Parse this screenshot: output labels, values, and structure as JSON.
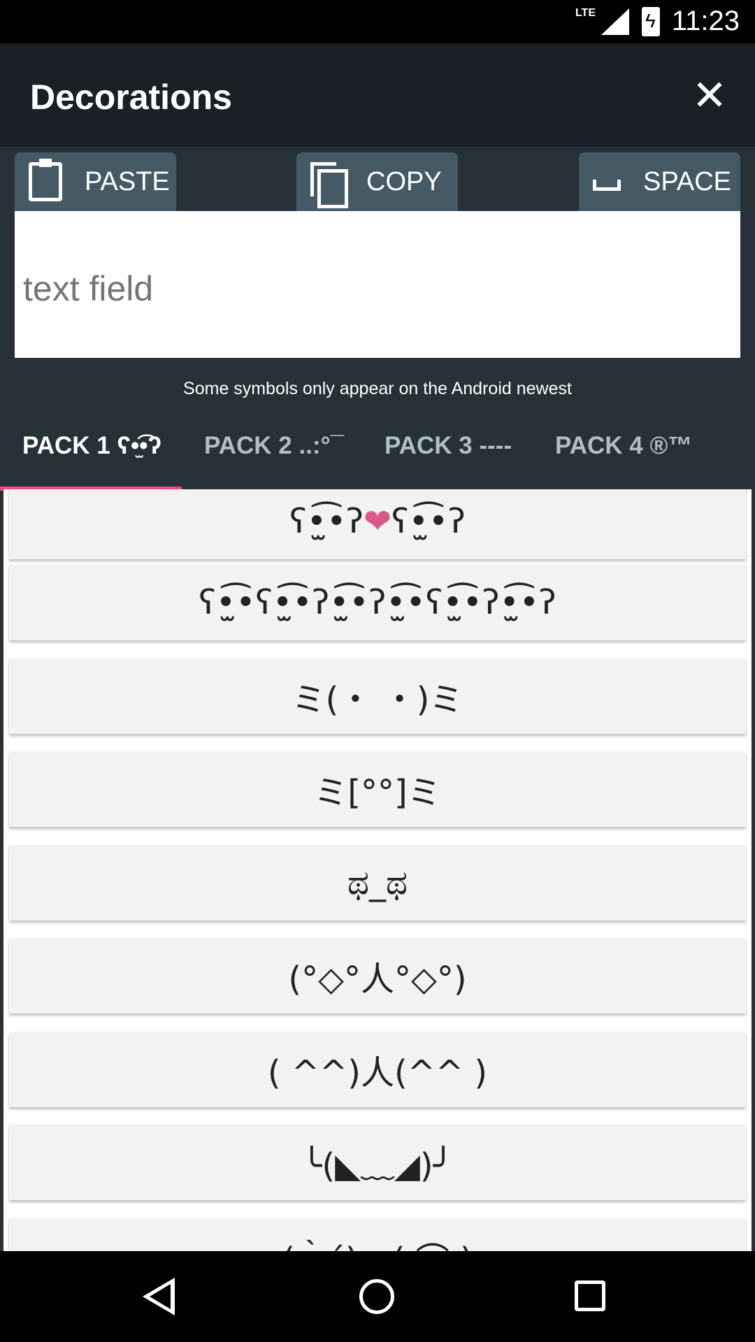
{
  "status_bar": {
    "network": "LTE",
    "time": "11:23"
  },
  "app_bar": {
    "title": "Decorations",
    "close_icon": "close-icon"
  },
  "toolbar": {
    "paste_label": "PASTE",
    "copy_label": "COPY",
    "space_label": "SPACE"
  },
  "text_field": {
    "placeholder": "text field",
    "value": ""
  },
  "notice": "Some symbols only appear on the Android newest",
  "tabs": [
    {
      "label": "PACK 1 ʕ•̫͡•ʔ",
      "active": true
    },
    {
      "label": "PACK 2 ..:°¯",
      "active": false
    },
    {
      "label": "PACK 3 ----",
      "active": false
    },
    {
      "label": "PACK 4 ®™",
      "active": false
    }
  ],
  "colors": {
    "accent": "#ff4081",
    "app_bar": "#1a2026",
    "background": "#263238",
    "button": "#455a64",
    "heart": "#d9578a"
  },
  "items": [
    "ʕ•̫͡•ʔ❤ʕ•̫͡•ʔ",
    "ʕ•̫͡•ʕ•̫͡•ʔ•̫͡•ʔ•̫͡•ʕ•̫͡•ʔ•̫͡•ʔ",
    "ミ(・ ・)ミ",
    "ミ[°°]ミ",
    "ಥ_ಥ",
    "(°◇°人°◇°)",
    "( ^^)人(^^ )",
    "╰(◣﹏◢)╯",
    "(｀´)ｏ( ⌒ )"
  ]
}
